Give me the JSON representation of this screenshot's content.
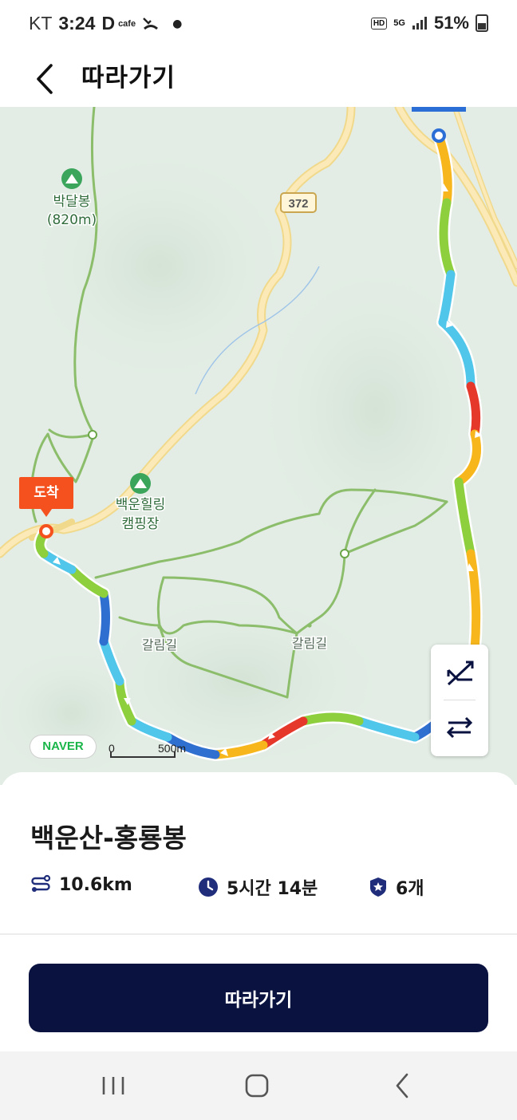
{
  "status_bar": {
    "carrier": "KT",
    "time": "3:24",
    "app_icon_d": "D",
    "app_icon_cafe": "cafe",
    "hd": "HD",
    "network": "5G",
    "battery": "51%"
  },
  "header": {
    "title": "따라가기"
  },
  "map": {
    "labels": {
      "peak": "박달봉",
      "peak_elev": "(820m)",
      "road_number": "372",
      "camp_line1": "백운힐링",
      "camp_line2": "캠핑장",
      "trail1": "갈림길",
      "trail2": "갈림길"
    },
    "arrive_tag": "도착",
    "naver": "NAVER",
    "scale_zero": "0",
    "scale_value": "500m",
    "colors": {
      "background": "#e3ede5",
      "road": "#f8e2a4",
      "trail": "#8bbd6a",
      "route_green": "#8ecf3e",
      "route_yellow": "#f7b71c",
      "route_cyan": "#4fc6ea",
      "route_blue": "#2f6fd0",
      "route_red": "#e5372a"
    }
  },
  "course": {
    "name": "백운산-홍룡봉",
    "distance": "10.6km",
    "duration": "5시간 14분",
    "stamps": "6개"
  },
  "actions": {
    "follow_label": "따라가기"
  }
}
